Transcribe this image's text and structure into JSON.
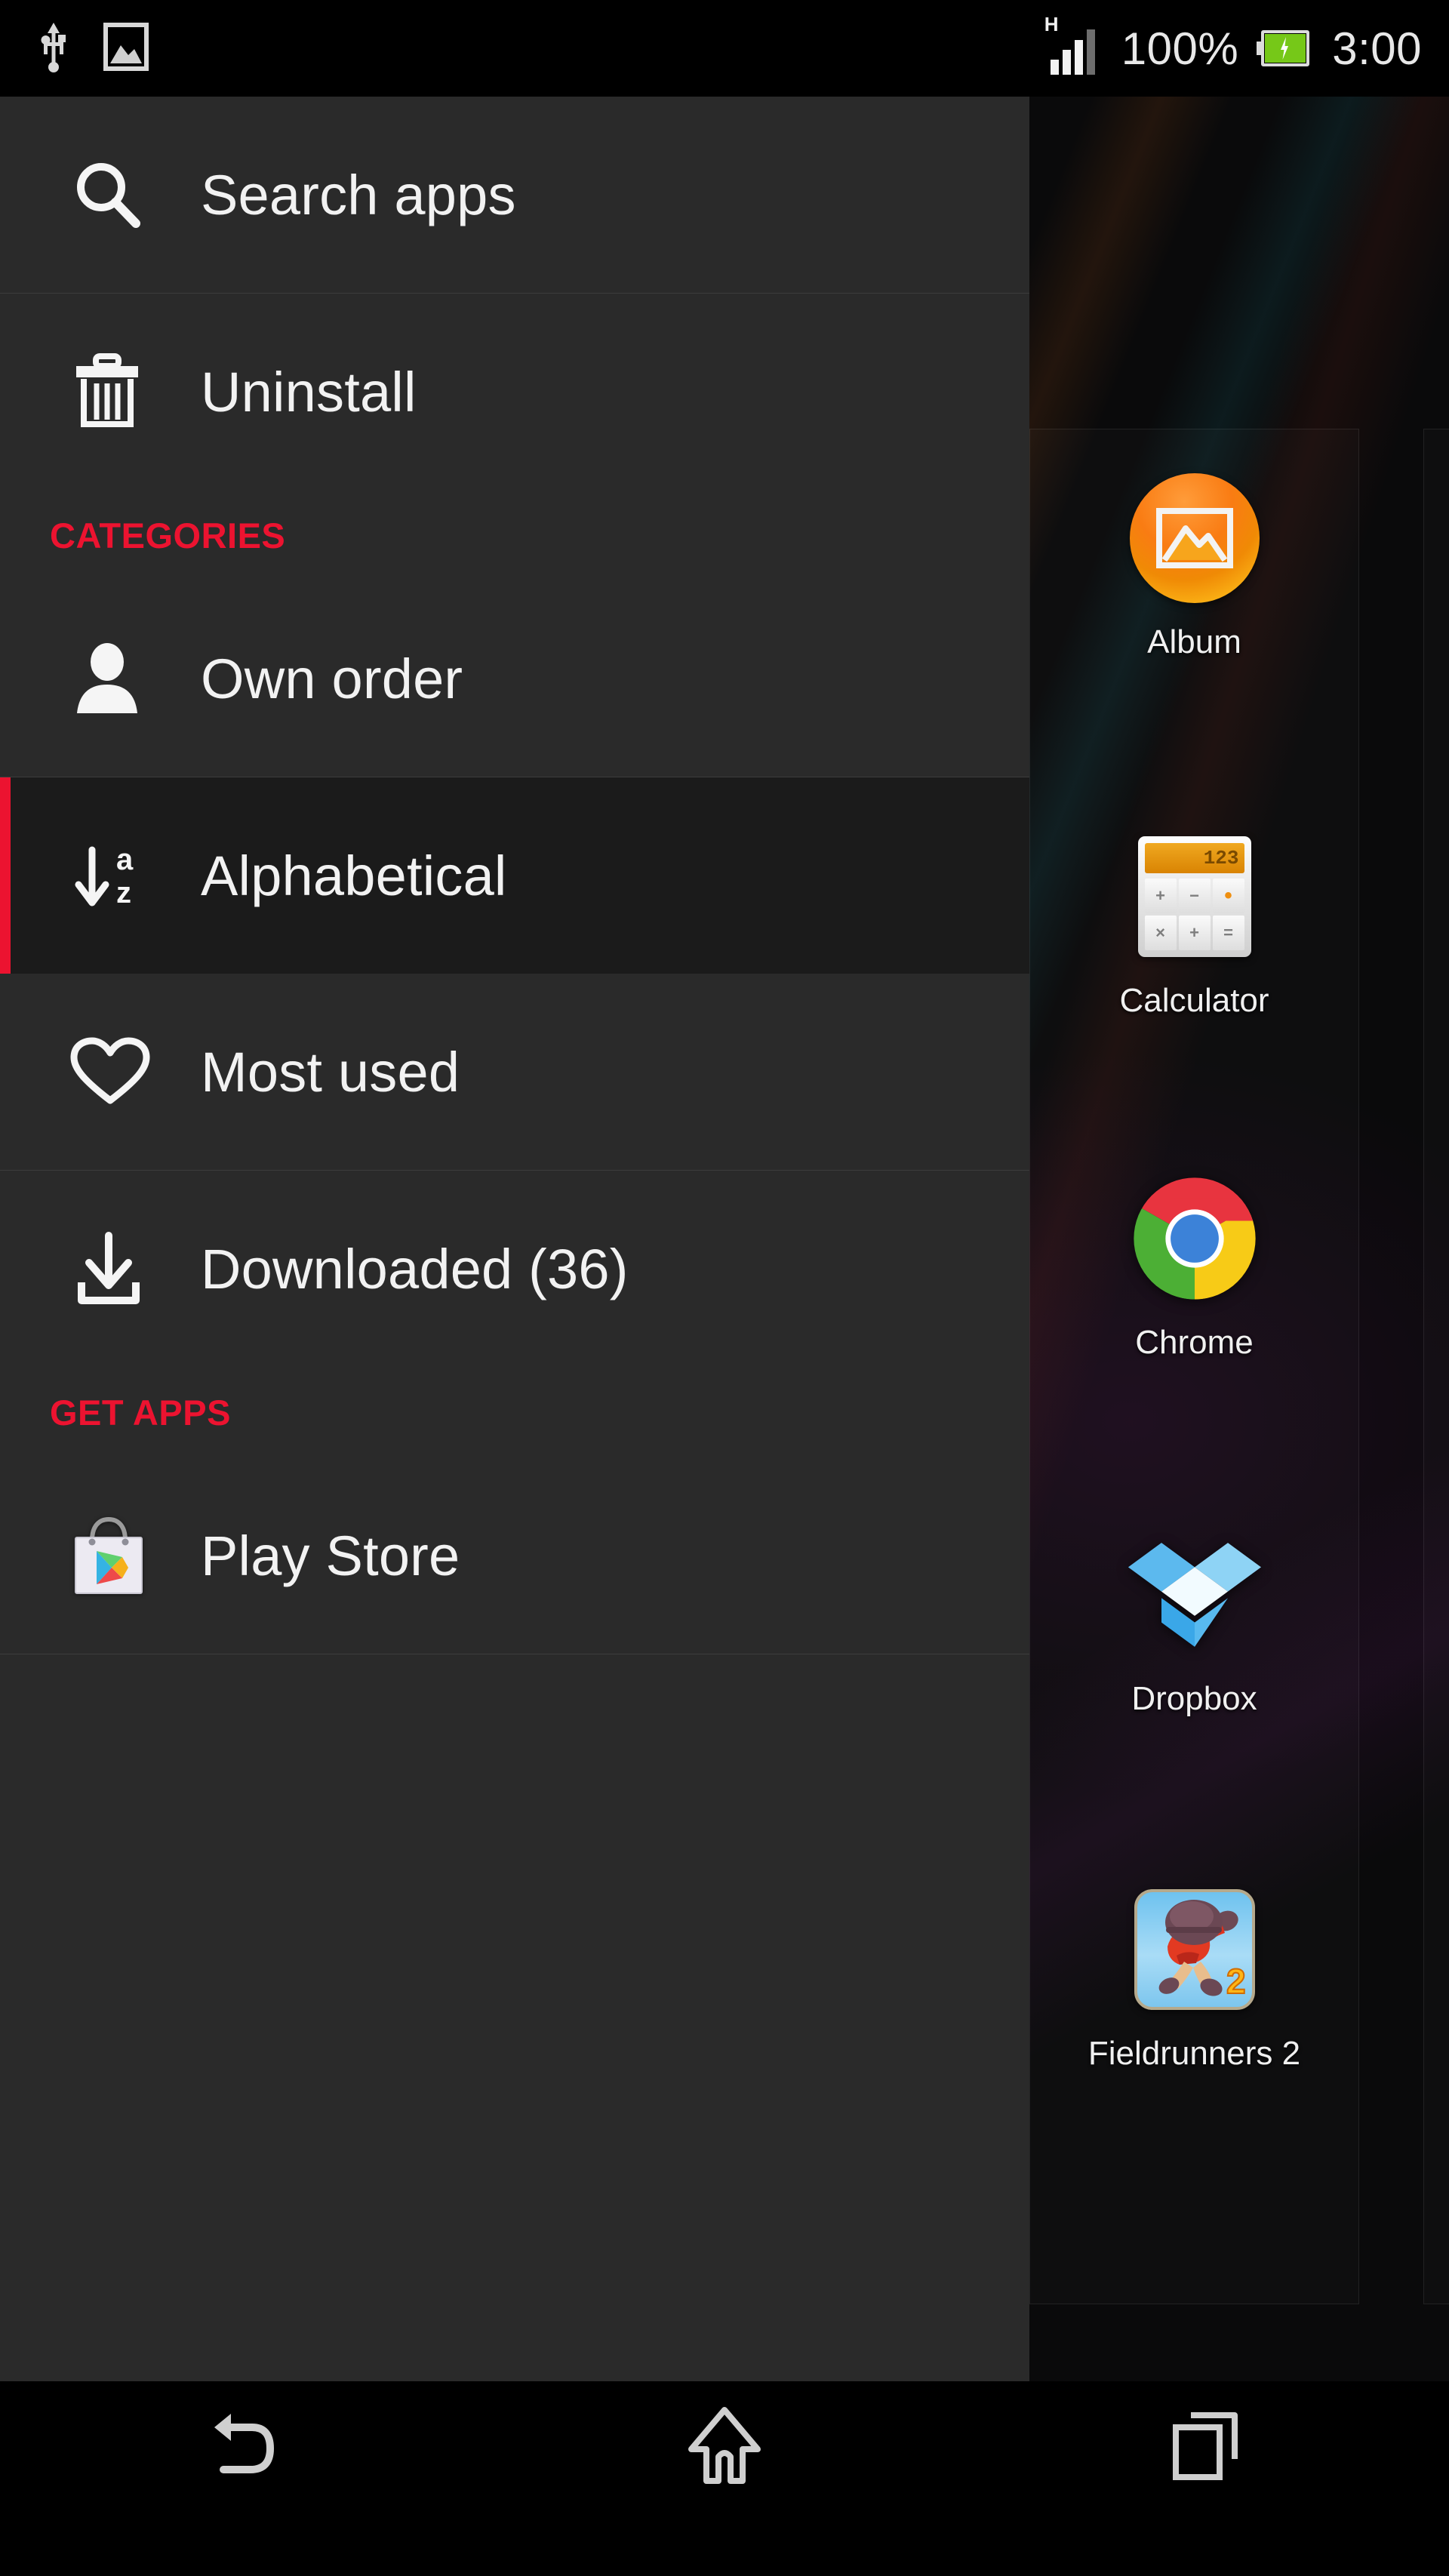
{
  "status_bar": {
    "usb_icon": "usb-icon",
    "screenshot_icon": "image-icon",
    "network_type": "H",
    "signal_icon": "signal-bars-icon",
    "battery_percent": "100%",
    "battery_icon": "battery-charging-icon",
    "clock": "3:00"
  },
  "drawer": {
    "items": [
      {
        "label": "Search apps",
        "icon": "search-icon",
        "selected": false,
        "type": "item"
      },
      {
        "label": "Uninstall",
        "icon": "trash-icon",
        "selected": false,
        "type": "item"
      },
      {
        "label": "CATEGORIES",
        "icon": "",
        "selected": false,
        "type": "section"
      },
      {
        "label": "Own order",
        "icon": "person-icon",
        "selected": false,
        "type": "item"
      },
      {
        "label": "Alphabetical",
        "icon": "sort-az-icon",
        "selected": true,
        "type": "item"
      },
      {
        "label": "Most used",
        "icon": "heart-icon",
        "selected": false,
        "type": "item"
      },
      {
        "label": "Downloaded (36)",
        "icon": "download-icon",
        "selected": false,
        "type": "item"
      },
      {
        "label": "GET APPS",
        "icon": "",
        "selected": false,
        "type": "section"
      },
      {
        "label": "Play Store",
        "icon": "play-store-icon",
        "selected": false,
        "type": "item"
      }
    ],
    "section_headings": {
      "categories": "CATEGORIES",
      "get_apps": "GET APPS"
    },
    "selected_item": "Alphabetical",
    "downloaded_count": "36"
  },
  "app_grid": {
    "apps": [
      {
        "label": "Album",
        "icon": "album-icon"
      },
      {
        "label": "Calculator",
        "icon": "calculator-icon"
      },
      {
        "label": "Chrome",
        "icon": "chrome-icon"
      },
      {
        "label": "Dropbox",
        "icon": "dropbox-icon"
      },
      {
        "label": "Fieldrunners 2",
        "icon": "fieldrunners-2-icon"
      }
    ],
    "calculator_display": "123"
  },
  "nav_bar": {
    "back": "back-button",
    "home": "home-button",
    "recents": "recent-apps-button"
  },
  "colors": {
    "accent_red": "#ec1330",
    "drawer_bg": "#2a2a2a",
    "selected_bg": "#1b1b1b",
    "text": "#f2f2f2",
    "battery_green": "#76c818"
  }
}
